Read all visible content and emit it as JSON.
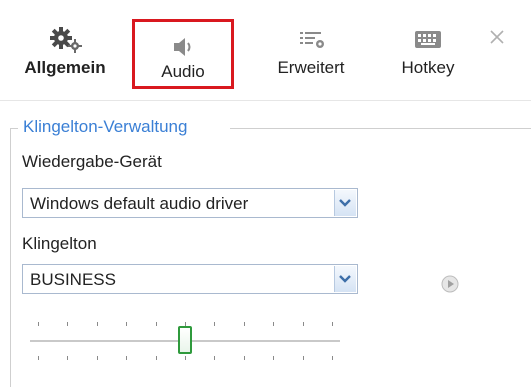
{
  "tabs": [
    {
      "label": "Allgemein",
      "icon": "gears-icon",
      "selected": false
    },
    {
      "label": "Audio",
      "icon": "speaker-icon",
      "selected": true
    },
    {
      "label": "Erweitert",
      "icon": "list-settings-icon",
      "selected": false
    },
    {
      "label": "Hotkey",
      "icon": "keyboard-icon",
      "selected": false
    }
  ],
  "close_icon": "close-icon",
  "group": {
    "title": "Klingelton-Verwaltung",
    "device_label": "Wiedergabe-Gerät",
    "device_value": "Windows default audio driver",
    "ringtone_label": "Klingelton",
    "ringtone_value": "BUSINESS",
    "play_icon": "play-icon",
    "volume_level_fraction": 0.5
  },
  "colors": {
    "highlight_border": "#d9181f",
    "group_title": "#3a7fd5",
    "slider_thumb_border": "#2f9a3c"
  }
}
